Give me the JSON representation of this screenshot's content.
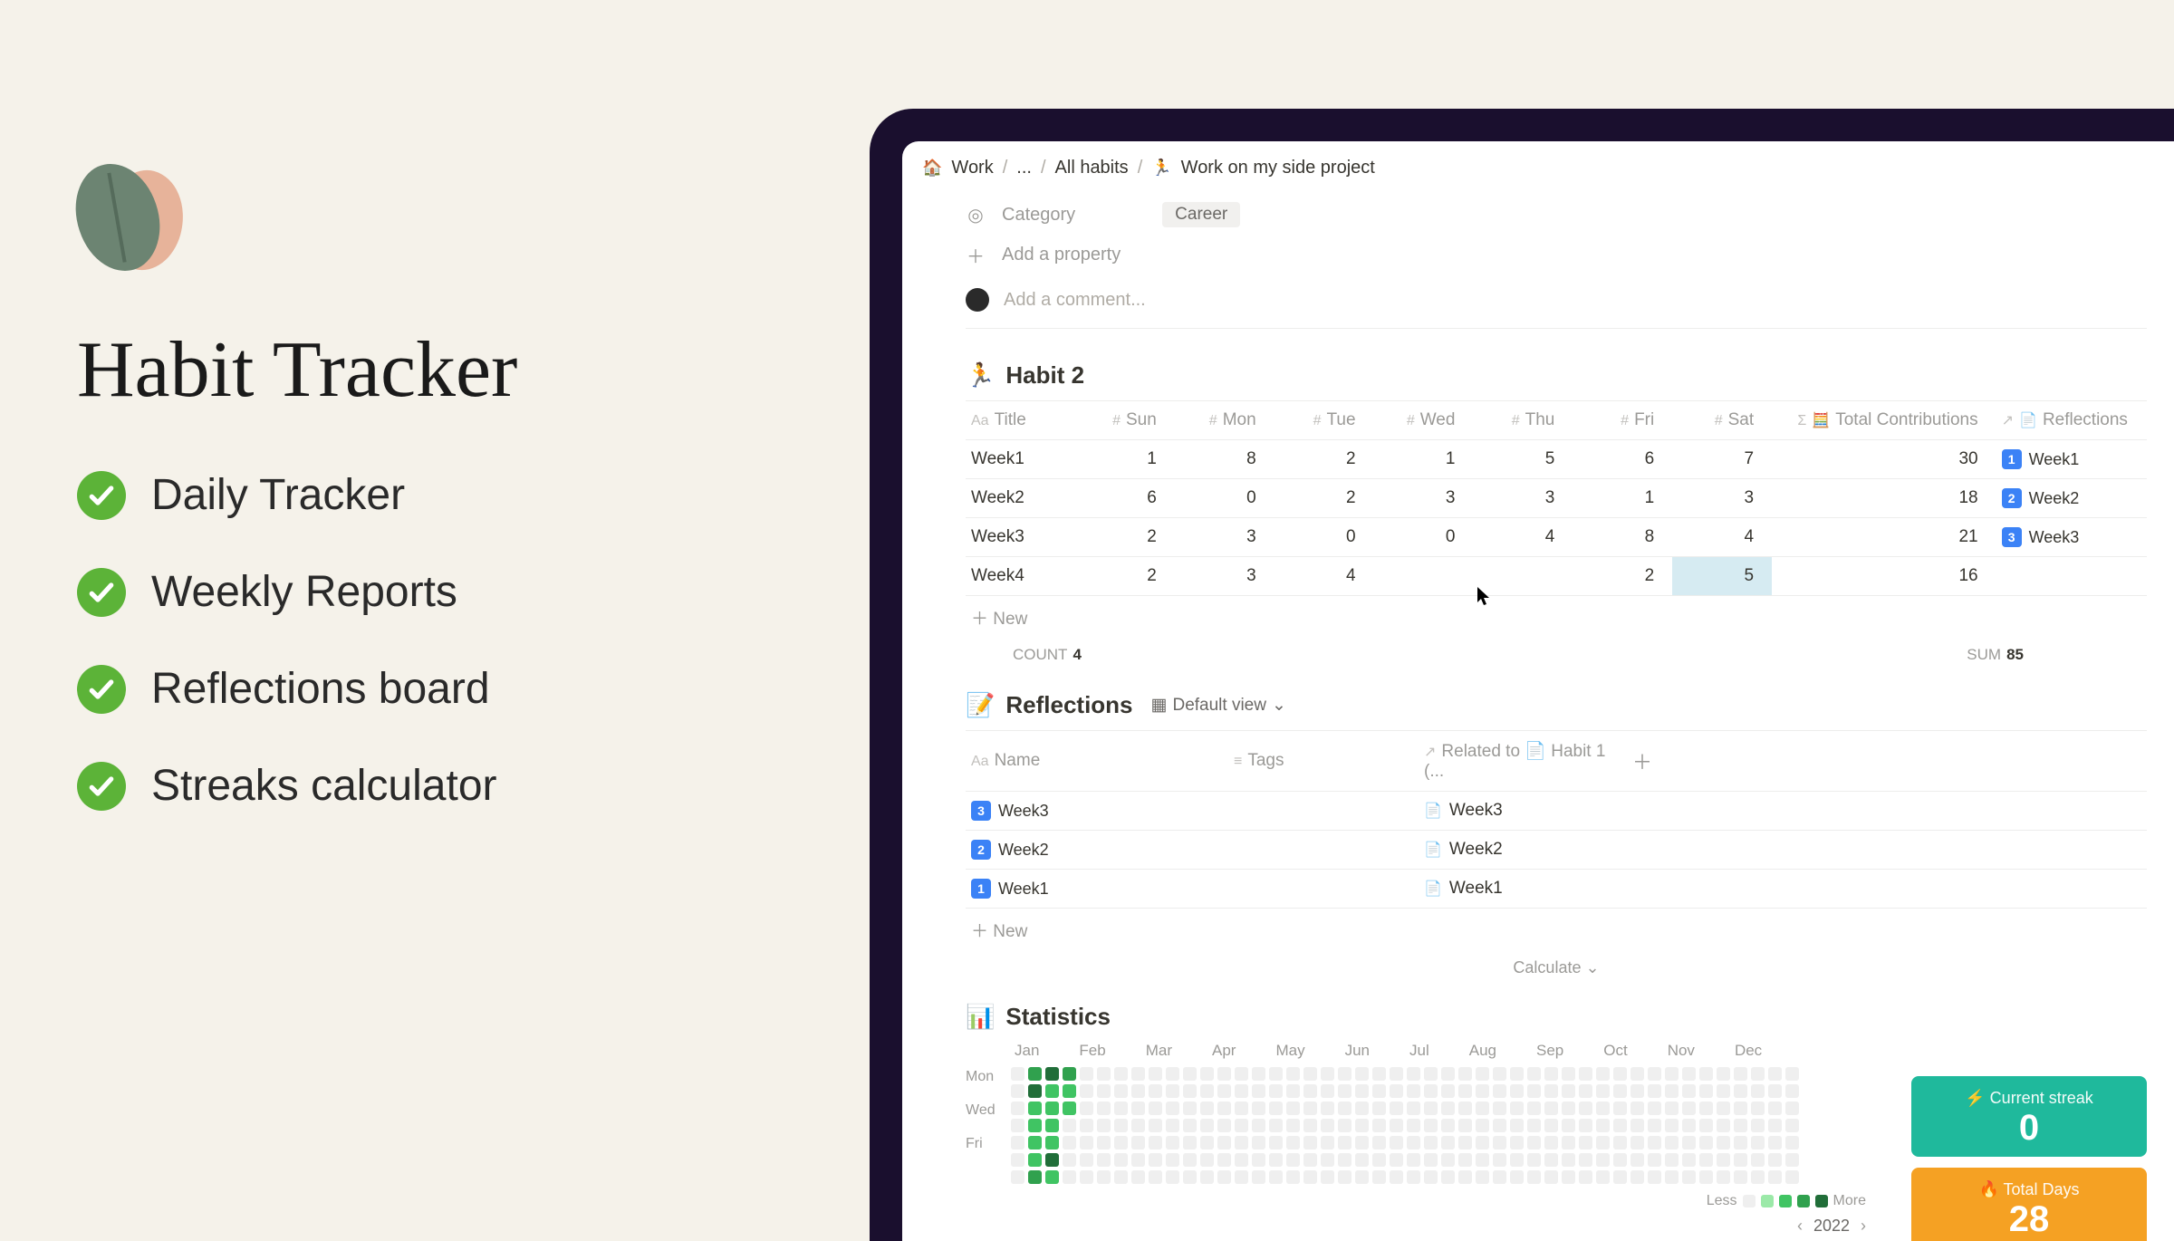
{
  "promo": {
    "title": "Habit Tracker",
    "features": [
      "Daily Tracker",
      "Weekly Reports",
      "Reflections board",
      "Streaks calculator"
    ]
  },
  "breadcrumb": {
    "root": "Work",
    "mid": "...",
    "db": "All habits",
    "page": "Work on my side project"
  },
  "properties": {
    "category_label": "Category",
    "category_value": "Career",
    "add_property": "Add a property"
  },
  "comment": {
    "placeholder": "Add a comment..."
  },
  "habit2": {
    "title": "Habit 2",
    "columns": {
      "title": "Title",
      "sun": "Sun",
      "mon": "Mon",
      "tue": "Tue",
      "wed": "Wed",
      "thu": "Thu",
      "fri": "Fri",
      "sat": "Sat",
      "total": "Total Contributions",
      "refl": "Reflections"
    },
    "rows": [
      {
        "title": "Week1",
        "sun": 1,
        "mon": 8,
        "tue": 2,
        "wed": 1,
        "thu": 5,
        "fri": 6,
        "sat": 7,
        "total": 30,
        "refl": "Week1",
        "refl_num": "1"
      },
      {
        "title": "Week2",
        "sun": 6,
        "mon": 0,
        "tue": 2,
        "wed": 3,
        "thu": 3,
        "fri": 1,
        "sat": 3,
        "total": 18,
        "refl": "Week2",
        "refl_num": "2"
      },
      {
        "title": "Week3",
        "sun": 2,
        "mon": 3,
        "tue": 0,
        "wed": 0,
        "thu": 4,
        "fri": 8,
        "sat": 4,
        "total": 21,
        "refl": "Week3",
        "refl_num": "3"
      },
      {
        "title": "Week4",
        "sun": 2,
        "mon": 3,
        "tue": 4,
        "wed": "",
        "thu": "",
        "fri": 2,
        "sat": 5,
        "total": 16,
        "refl": "",
        "refl_num": ""
      }
    ],
    "new_label": "New",
    "count_label": "COUNT",
    "count_value": "4",
    "sum_label": "SUM",
    "sum_value": "85"
  },
  "reflections": {
    "title": "Reflections",
    "view_label": "Default view",
    "columns": {
      "name": "Name",
      "tags": "Tags",
      "related": "Related to 📄 Habit 1 (..."
    },
    "rows": [
      {
        "num": "3",
        "name": "Week3",
        "rel": "Week3"
      },
      {
        "num": "2",
        "name": "Week2",
        "rel": "Week2"
      },
      {
        "num": "1",
        "name": "Week1",
        "rel": "Week1"
      }
    ],
    "new_label": "New",
    "calculate": "Calculate"
  },
  "statistics": {
    "title": "Statistics",
    "months": [
      "Jan",
      "Feb",
      "Mar",
      "Apr",
      "May",
      "Jun",
      "Jul",
      "Aug",
      "Sep",
      "Oct",
      "Nov",
      "Dec"
    ],
    "day_labels": [
      "Mon",
      "Wed",
      "Fri"
    ],
    "legend_less": "Less",
    "legend_more": "More",
    "year": "2022",
    "cards": {
      "streak_label": "⚡ Current streak",
      "streak_value": "0",
      "total_label": "🔥 Total Days",
      "total_value": "28"
    },
    "heatmap": [
      [
        0,
        3,
        4,
        3,
        0,
        0,
        0,
        0,
        0,
        0,
        0,
        0,
        0,
        0,
        0,
        0,
        0,
        0,
        0,
        0,
        0,
        0,
        0,
        0,
        0,
        0,
        0,
        0,
        0,
        0,
        0,
        0,
        0,
        0,
        0,
        0,
        0,
        0,
        0,
        0,
        0,
        0,
        0,
        0,
        0,
        0
      ],
      [
        0,
        4,
        2,
        2,
        0,
        0,
        0,
        0,
        0,
        0,
        0,
        0,
        0,
        0,
        0,
        0,
        0,
        0,
        0,
        0,
        0,
        0,
        0,
        0,
        0,
        0,
        0,
        0,
        0,
        0,
        0,
        0,
        0,
        0,
        0,
        0,
        0,
        0,
        0,
        0,
        0,
        0,
        0,
        0,
        0,
        0
      ],
      [
        0,
        2,
        2,
        2,
        0,
        0,
        0,
        0,
        0,
        0,
        0,
        0,
        0,
        0,
        0,
        0,
        0,
        0,
        0,
        0,
        0,
        0,
        0,
        0,
        0,
        0,
        0,
        0,
        0,
        0,
        0,
        0,
        0,
        0,
        0,
        0,
        0,
        0,
        0,
        0,
        0,
        0,
        0,
        0,
        0,
        0
      ],
      [
        0,
        2,
        2,
        0,
        0,
        0,
        0,
        0,
        0,
        0,
        0,
        0,
        0,
        0,
        0,
        0,
        0,
        0,
        0,
        0,
        0,
        0,
        0,
        0,
        0,
        0,
        0,
        0,
        0,
        0,
        0,
        0,
        0,
        0,
        0,
        0,
        0,
        0,
        0,
        0,
        0,
        0,
        0,
        0,
        0,
        0
      ],
      [
        0,
        2,
        2,
        0,
        0,
        0,
        0,
        0,
        0,
        0,
        0,
        0,
        0,
        0,
        0,
        0,
        0,
        0,
        0,
        0,
        0,
        0,
        0,
        0,
        0,
        0,
        0,
        0,
        0,
        0,
        0,
        0,
        0,
        0,
        0,
        0,
        0,
        0,
        0,
        0,
        0,
        0,
        0,
        0,
        0,
        0
      ],
      [
        0,
        2,
        4,
        0,
        0,
        0,
        0,
        0,
        0,
        0,
        0,
        0,
        0,
        0,
        0,
        0,
        0,
        0,
        0,
        0,
        0,
        0,
        0,
        0,
        0,
        0,
        0,
        0,
        0,
        0,
        0,
        0,
        0,
        0,
        0,
        0,
        0,
        0,
        0,
        0,
        0,
        0,
        0,
        0,
        0,
        0
      ],
      [
        0,
        3,
        2,
        0,
        0,
        0,
        0,
        0,
        0,
        0,
        0,
        0,
        0,
        0,
        0,
        0,
        0,
        0,
        0,
        0,
        0,
        0,
        0,
        0,
        0,
        0,
        0,
        0,
        0,
        0,
        0,
        0,
        0,
        0,
        0,
        0,
        0,
        0,
        0,
        0,
        0,
        0,
        0,
        0,
        0,
        0
      ]
    ]
  }
}
